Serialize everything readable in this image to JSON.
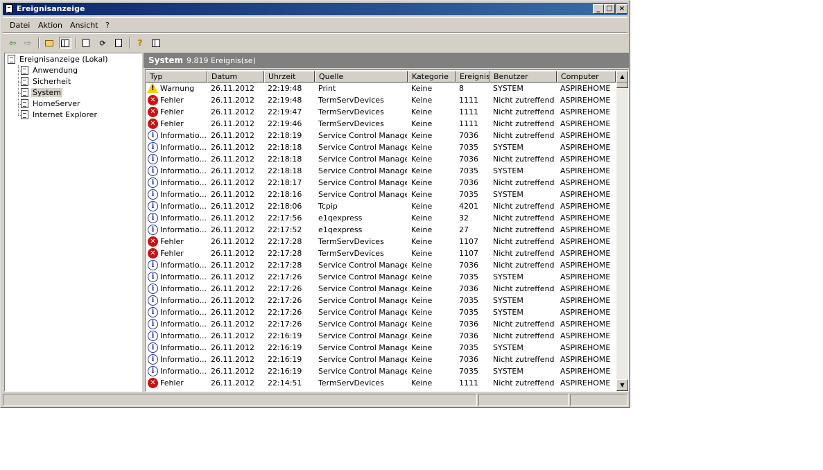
{
  "window": {
    "title": "Ereignisanzeige",
    "controls": {
      "minimize": "_",
      "maximize": "□",
      "close": "×"
    }
  },
  "menu": [
    "Datei",
    "Aktion",
    "Ansicht",
    "?"
  ],
  "toolbar": {
    "icons": [
      "back-arrow-icon",
      "forward-arrow-icon",
      "up-folder-icon",
      "show-hide-tree-icon",
      "properties-icon",
      "refresh-icon",
      "export-list-icon",
      "help-icon",
      "action-pane-icon"
    ]
  },
  "tree": {
    "root": "Ereignisanzeige (Lokal)",
    "items": [
      "Anwendung",
      "Sicherheit",
      "System",
      "HomeServer",
      "Internet Explorer"
    ],
    "selected": "System"
  },
  "banner": {
    "title": "System",
    "count": "9.819 Ereignis(se)"
  },
  "columns": [
    "Typ",
    "Datum",
    "Uhrzeit",
    "Quelle",
    "Kategorie",
    "Ereignis",
    "Benutzer",
    "Computer"
  ],
  "rows": [
    {
      "kind": "warn",
      "typ": "Warnung",
      "datum": "26.11.2012",
      "uhrzeit": "22:19:48",
      "quelle": "Print",
      "kategorie": "Keine",
      "ereignis": "8",
      "benutzer": "SYSTEM",
      "computer": "ASPIREHOME"
    },
    {
      "kind": "err",
      "typ": "Fehler",
      "datum": "26.11.2012",
      "uhrzeit": "22:19:48",
      "quelle": "TermServDevices",
      "kategorie": "Keine",
      "ereignis": "1111",
      "benutzer": "Nicht zutreffend",
      "computer": "ASPIREHOME"
    },
    {
      "kind": "err",
      "typ": "Fehler",
      "datum": "26.11.2012",
      "uhrzeit": "22:19:47",
      "quelle": "TermServDevices",
      "kategorie": "Keine",
      "ereignis": "1111",
      "benutzer": "Nicht zutreffend",
      "computer": "ASPIREHOME"
    },
    {
      "kind": "err",
      "typ": "Fehler",
      "datum": "26.11.2012",
      "uhrzeit": "22:19:46",
      "quelle": "TermServDevices",
      "kategorie": "Keine",
      "ereignis": "1111",
      "benutzer": "Nicht zutreffend",
      "computer": "ASPIREHOME"
    },
    {
      "kind": "info",
      "typ": "Informatio...",
      "datum": "26.11.2012",
      "uhrzeit": "22:18:19",
      "quelle": "Service Control Manager",
      "kategorie": "Keine",
      "ereignis": "7036",
      "benutzer": "Nicht zutreffend",
      "computer": "ASPIREHOME"
    },
    {
      "kind": "info",
      "typ": "Informatio...",
      "datum": "26.11.2012",
      "uhrzeit": "22:18:18",
      "quelle": "Service Control Manager",
      "kategorie": "Keine",
      "ereignis": "7035",
      "benutzer": "SYSTEM",
      "computer": "ASPIREHOME"
    },
    {
      "kind": "info",
      "typ": "Informatio...",
      "datum": "26.11.2012",
      "uhrzeit": "22:18:18",
      "quelle": "Service Control Manager",
      "kategorie": "Keine",
      "ereignis": "7036",
      "benutzer": "Nicht zutreffend",
      "computer": "ASPIREHOME"
    },
    {
      "kind": "info",
      "typ": "Informatio...",
      "datum": "26.11.2012",
      "uhrzeit": "22:18:18",
      "quelle": "Service Control Manager",
      "kategorie": "Keine",
      "ereignis": "7035",
      "benutzer": "SYSTEM",
      "computer": "ASPIREHOME"
    },
    {
      "kind": "info",
      "typ": "Informatio...",
      "datum": "26.11.2012",
      "uhrzeit": "22:18:17",
      "quelle": "Service Control Manager",
      "kategorie": "Keine",
      "ereignis": "7036",
      "benutzer": "Nicht zutreffend",
      "computer": "ASPIREHOME"
    },
    {
      "kind": "info",
      "typ": "Informatio...",
      "datum": "26.11.2012",
      "uhrzeit": "22:18:16",
      "quelle": "Service Control Manager",
      "kategorie": "Keine",
      "ereignis": "7035",
      "benutzer": "SYSTEM",
      "computer": "ASPIREHOME"
    },
    {
      "kind": "info",
      "typ": "Informatio...",
      "datum": "26.11.2012",
      "uhrzeit": "22:18:06",
      "quelle": "Tcpip",
      "kategorie": "Keine",
      "ereignis": "4201",
      "benutzer": "Nicht zutreffend",
      "computer": "ASPIREHOME"
    },
    {
      "kind": "info",
      "typ": "Informatio...",
      "datum": "26.11.2012",
      "uhrzeit": "22:17:56",
      "quelle": "e1qexpress",
      "kategorie": "Keine",
      "ereignis": "32",
      "benutzer": "Nicht zutreffend",
      "computer": "ASPIREHOME"
    },
    {
      "kind": "info",
      "typ": "Informatio...",
      "datum": "26.11.2012",
      "uhrzeit": "22:17:52",
      "quelle": "e1qexpress",
      "kategorie": "Keine",
      "ereignis": "27",
      "benutzer": "Nicht zutreffend",
      "computer": "ASPIREHOME"
    },
    {
      "kind": "err",
      "typ": "Fehler",
      "datum": "26.11.2012",
      "uhrzeit": "22:17:28",
      "quelle": "TermServDevices",
      "kategorie": "Keine",
      "ereignis": "1107",
      "benutzer": "Nicht zutreffend",
      "computer": "ASPIREHOME"
    },
    {
      "kind": "err",
      "typ": "Fehler",
      "datum": "26.11.2012",
      "uhrzeit": "22:17:28",
      "quelle": "TermServDevices",
      "kategorie": "Keine",
      "ereignis": "1107",
      "benutzer": "Nicht zutreffend",
      "computer": "ASPIREHOME"
    },
    {
      "kind": "info",
      "typ": "Informatio...",
      "datum": "26.11.2012",
      "uhrzeit": "22:17:28",
      "quelle": "Service Control Manager",
      "kategorie": "Keine",
      "ereignis": "7036",
      "benutzer": "Nicht zutreffend",
      "computer": "ASPIREHOME"
    },
    {
      "kind": "info",
      "typ": "Informatio...",
      "datum": "26.11.2012",
      "uhrzeit": "22:17:26",
      "quelle": "Service Control Manager",
      "kategorie": "Keine",
      "ereignis": "7035",
      "benutzer": "SYSTEM",
      "computer": "ASPIREHOME"
    },
    {
      "kind": "info",
      "typ": "Informatio...",
      "datum": "26.11.2012",
      "uhrzeit": "22:17:26",
      "quelle": "Service Control Manager",
      "kategorie": "Keine",
      "ereignis": "7036",
      "benutzer": "Nicht zutreffend",
      "computer": "ASPIREHOME"
    },
    {
      "kind": "info",
      "typ": "Informatio...",
      "datum": "26.11.2012",
      "uhrzeit": "22:17:26",
      "quelle": "Service Control Manager",
      "kategorie": "Keine",
      "ereignis": "7035",
      "benutzer": "SYSTEM",
      "computer": "ASPIREHOME"
    },
    {
      "kind": "info",
      "typ": "Informatio...",
      "datum": "26.11.2012",
      "uhrzeit": "22:17:26",
      "quelle": "Service Control Manager",
      "kategorie": "Keine",
      "ereignis": "7035",
      "benutzer": "SYSTEM",
      "computer": "ASPIREHOME"
    },
    {
      "kind": "info",
      "typ": "Informatio...",
      "datum": "26.11.2012",
      "uhrzeit": "22:17:26",
      "quelle": "Service Control Manager",
      "kategorie": "Keine",
      "ereignis": "7036",
      "benutzer": "Nicht zutreffend",
      "computer": "ASPIREHOME"
    },
    {
      "kind": "info",
      "typ": "Informatio...",
      "datum": "26.11.2012",
      "uhrzeit": "22:16:19",
      "quelle": "Service Control Manager",
      "kategorie": "Keine",
      "ereignis": "7036",
      "benutzer": "Nicht zutreffend",
      "computer": "ASPIREHOME"
    },
    {
      "kind": "info",
      "typ": "Informatio...",
      "datum": "26.11.2012",
      "uhrzeit": "22:16:19",
      "quelle": "Service Control Manager",
      "kategorie": "Keine",
      "ereignis": "7035",
      "benutzer": "SYSTEM",
      "computer": "ASPIREHOME"
    },
    {
      "kind": "info",
      "typ": "Informatio...",
      "datum": "26.11.2012",
      "uhrzeit": "22:16:19",
      "quelle": "Service Control Manager",
      "kategorie": "Keine",
      "ereignis": "7036",
      "benutzer": "Nicht zutreffend",
      "computer": "ASPIREHOME"
    },
    {
      "kind": "info",
      "typ": "Informatio...",
      "datum": "26.11.2012",
      "uhrzeit": "22:16:19",
      "quelle": "Service Control Manager",
      "kategorie": "Keine",
      "ereignis": "7035",
      "benutzer": "SYSTEM",
      "computer": "ASPIREHOME"
    },
    {
      "kind": "err",
      "typ": "Fehler",
      "datum": "26.11.2012",
      "uhrzeit": "22:14:51",
      "quelle": "TermServDevices",
      "kategorie": "Keine",
      "ereignis": "1111",
      "benutzer": "Nicht zutreffend",
      "computer": "ASPIREHOME"
    }
  ],
  "colors": {
    "titlebar_start": "#0a246a",
    "titlebar_end": "#3a6ea5",
    "face": "#d4d0c8",
    "banner": "#808080"
  }
}
